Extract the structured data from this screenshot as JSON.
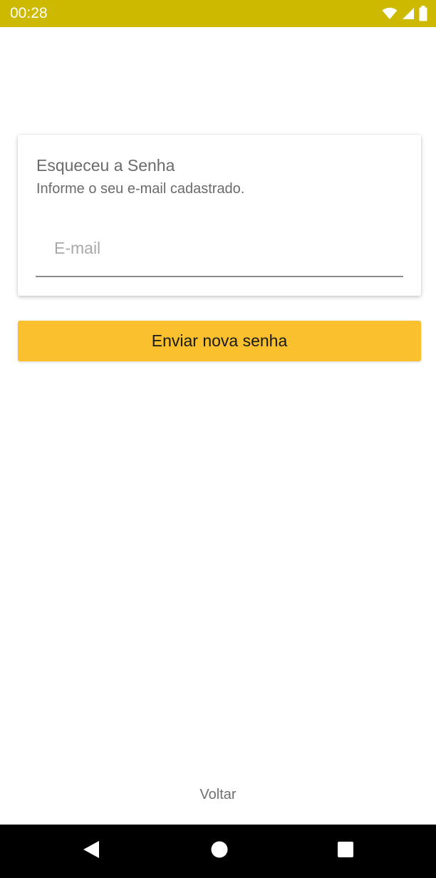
{
  "status_bar": {
    "time": "00:28",
    "icons": [
      "wifi-icon",
      "signal-icon",
      "battery-icon"
    ],
    "background_color": "#cdba00"
  },
  "card": {
    "title": "Esqueceu a Senha",
    "subtitle": "Informe o seu e-mail cadastrado.",
    "email_field": {
      "value": "",
      "placeholder": "E-mail"
    }
  },
  "actions": {
    "send_label": "Enviar nova senha",
    "send_color": "#fbc02d",
    "back_label": "Voltar"
  },
  "navigation_bar": {
    "buttons": [
      "back-icon",
      "home-icon",
      "recents-icon"
    ]
  }
}
